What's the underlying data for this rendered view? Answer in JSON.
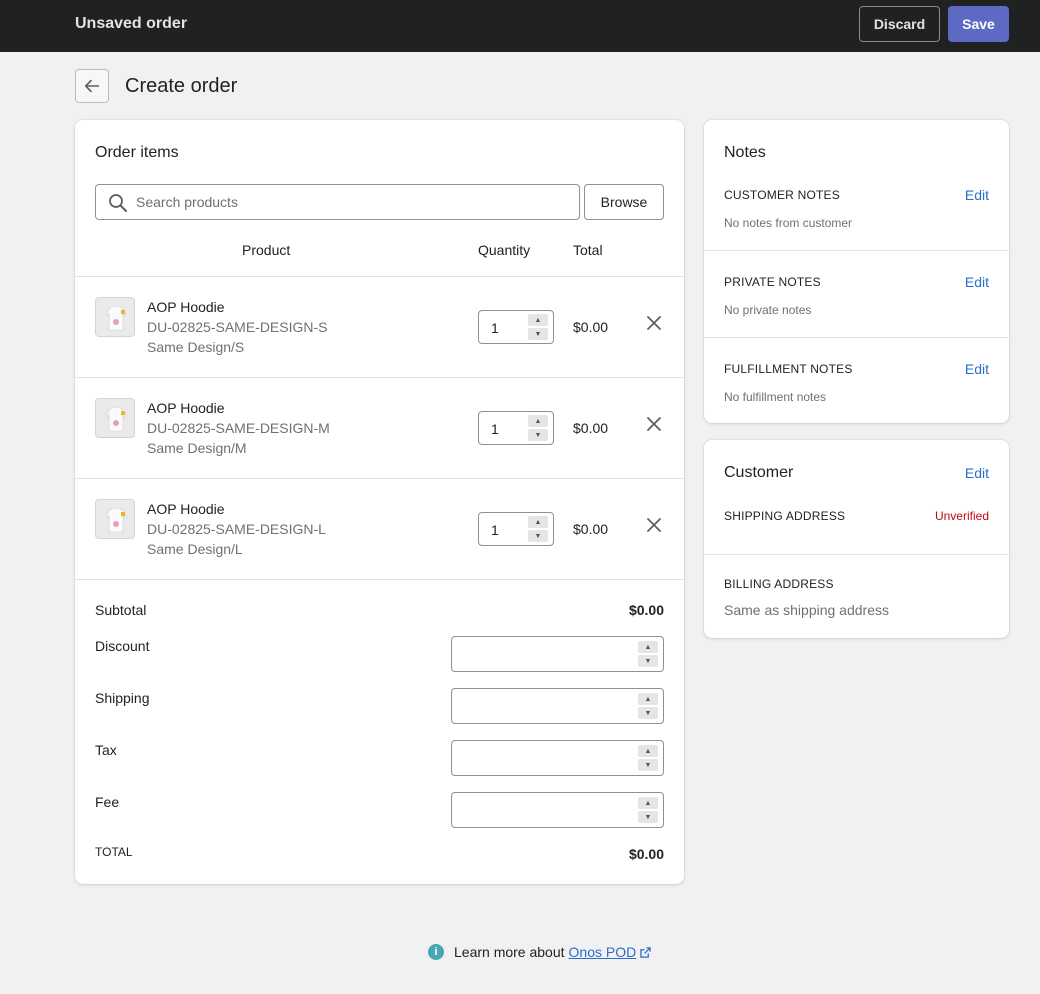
{
  "topbar": {
    "title": "Unsaved order",
    "discard_label": "Discard",
    "save_label": "Save"
  },
  "page": {
    "title": "Create order"
  },
  "order_items": {
    "heading": "Order items",
    "search_placeholder": "Search products",
    "browse_label": "Browse",
    "columns": {
      "product": "Product",
      "quantity": "Quantity",
      "total": "Total"
    },
    "items": [
      {
        "name": "AOP Hoodie",
        "sku": "DU-02825-SAME-DESIGN-S",
        "variant": "Same Design/S",
        "quantity": "1",
        "total": "$0.00"
      },
      {
        "name": "AOP Hoodie",
        "sku": "DU-02825-SAME-DESIGN-M",
        "variant": "Same Design/M",
        "quantity": "1",
        "total": "$0.00"
      },
      {
        "name": "AOP Hoodie",
        "sku": "DU-02825-SAME-DESIGN-L",
        "variant": "Same Design/L",
        "quantity": "1",
        "total": "$0.00"
      }
    ],
    "summary": {
      "subtotal_label": "Subtotal",
      "subtotal_value": "$0.00",
      "discount_label": "Discount",
      "shipping_label": "Shipping",
      "tax_label": "Tax",
      "fee_label": "Fee",
      "total_label": "TOTAL",
      "total_value": "$0.00"
    }
  },
  "notes": {
    "heading": "Notes",
    "sections": [
      {
        "title": "CUSTOMER NOTES",
        "text": "No notes from customer",
        "edit": "Edit"
      },
      {
        "title": "PRIVATE NOTES",
        "text": "No private notes",
        "edit": "Edit"
      },
      {
        "title": "FULFILLMENT NOTES",
        "text": "No fulfillment notes",
        "edit": "Edit"
      }
    ]
  },
  "customer": {
    "heading": "Customer",
    "edit": "Edit",
    "shipping_title": "SHIPPING ADDRESS",
    "shipping_status": "Unverified",
    "billing_title": "BILLING ADDRESS",
    "billing_text": "Same as shipping address"
  },
  "footer": {
    "text": "Learn more about",
    "link": "Onos POD"
  },
  "colors": {
    "primary": "#5c6ac4",
    "topbar": "#202123",
    "link": "#2c6ecb",
    "critical": "#bf0711",
    "info": "#47a7b4"
  }
}
